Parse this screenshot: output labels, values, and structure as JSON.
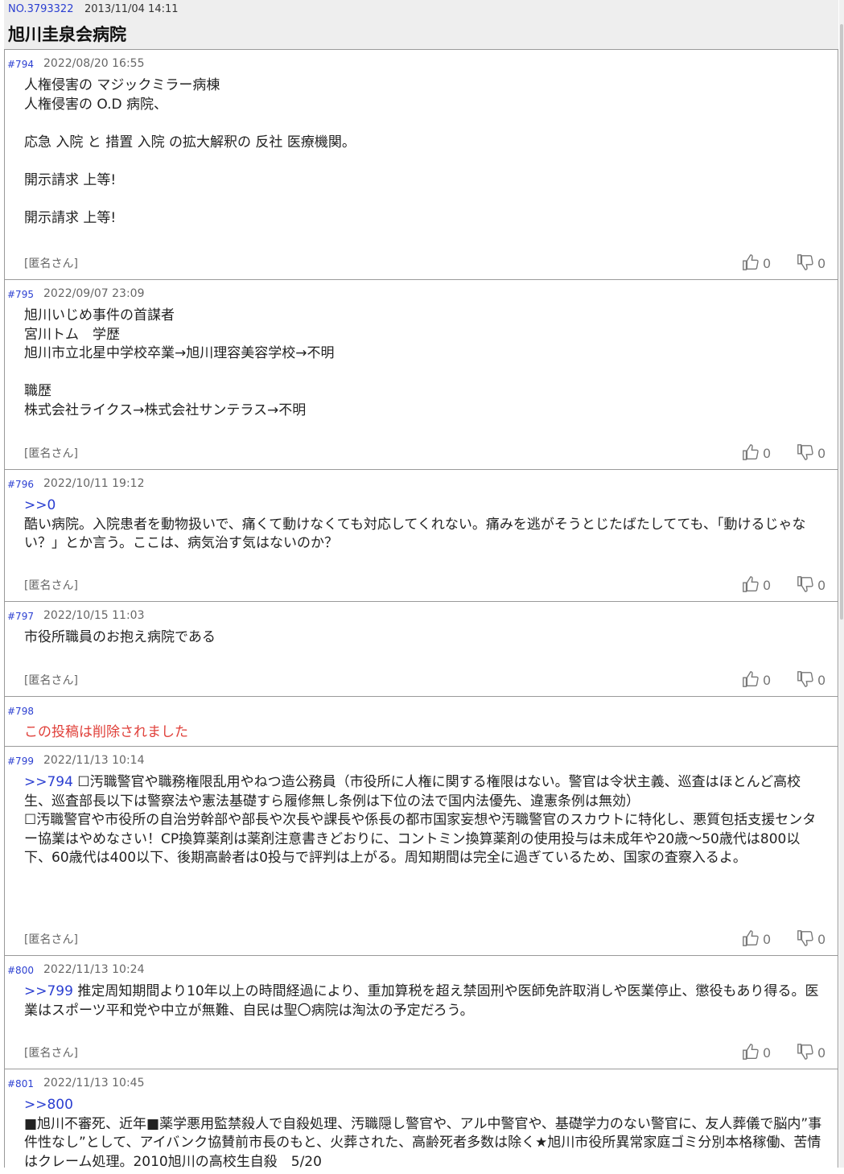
{
  "thread": {
    "number": "NO.3793322",
    "created": "2013/11/04 14:11",
    "title": "旭川圭泉会病院"
  },
  "posts": [
    {
      "num": "#794",
      "date": "2022/08/20 16:55",
      "body": "人権侵害の マジックミラー病棟\n人権侵害の O.D 病院、\n\n応急 入院 と 措置 入院 の拡大解釈の 反社 医療機関。\n\n開示請求 上等!\n\n開示請求 上等!",
      "author": "[匿名さん]",
      "likes": "0",
      "dislikes": "0"
    },
    {
      "num": "#795",
      "date": "2022/09/07 23:09",
      "body": "旭川いじめ事件の首謀者\n宮川トム　学歴\n旭川市立北星中学校卒業→旭川理容美容学校→不明\n\n職歴\n株式会社ライクス→株式会社サンテラス→不明",
      "author": "[匿名さん]",
      "likes": "0",
      "dislikes": "0"
    },
    {
      "num": "#796",
      "date": "2022/10/11 19:12",
      "reply": ">>0",
      "body": "酷い病院。入院患者を動物扱いで、痛くて動けなくても対応してくれない。痛みを逃がそうとじたばたしてても、「動けるじゃない？」とか言う。ここは、病気治す気はないのか？",
      "author": "[匿名さん]",
      "likes": "0",
      "dislikes": "0"
    },
    {
      "num": "#797",
      "date": "2022/10/15 11:03",
      "body": "市役所職員のお抱え病院である",
      "author": "[匿名さん]",
      "likes": "0",
      "dislikes": "0"
    },
    {
      "num": "#798",
      "deleted_text": "この投稿は削除されました"
    },
    {
      "num": "#799",
      "date": "2022/11/13 10:14",
      "reply": ">>794",
      "body": "☐汚職警官や職務権限乱用やねつ造公務員（市役所に人権に関する権限はない。警官は令状主義、巡査はほとんど高校生、巡査部長以下は警察法や憲法基礎すら履修無し条例は下位の法で国内法優先、違憲条例は無効）\n☐汚職警官や市役所の自治労幹部や部長や次長や課長や係長の都市国家妄想や汚職警官のスカウトに特化し、悪質包括支援センター協業はやめなさい！CP換算薬剤は薬剤注意書きどおりに、コントミン換算薬剤の使用投与は未成年や20歳～50歳代は800以下、60歳代は400以下、後期高齢者は0投与で評判は上がる。周知期間は完全に過ぎているため、国家の査察入るよ。",
      "author": "[匿名さん]",
      "likes": "0",
      "dislikes": "0"
    },
    {
      "num": "#800",
      "date": "2022/11/13 10:24",
      "reply": ">>799",
      "body": "推定周知期間より10年以上の時間経過により、重加算税を超え禁固刑や医師免許取消しや医業停止、懲役もあり得る。医業はスポーツ平和党や中立が無難、自民は聖〇病院は淘汰の予定だろう。",
      "author": "[匿名さん]",
      "likes": "0",
      "dislikes": "0"
    },
    {
      "num": "#801",
      "date": "2022/11/13 10:45",
      "reply": ">>800",
      "body": "■旭川不審死、近年■薬学悪用監禁殺人で自殺処理、汚職隠し警官や、アル中警官や、基礎学力のない警官に、友人葬儀で脳内”事件性なし”として、アイバンク協賛前市長のもと、火葬された、高齢死者多数は除く★旭川市役所異常家庭ゴミ分別本格稼働、苦情はクレーム処理。2010旭川の高校生自殺　5/20"
    }
  ]
}
